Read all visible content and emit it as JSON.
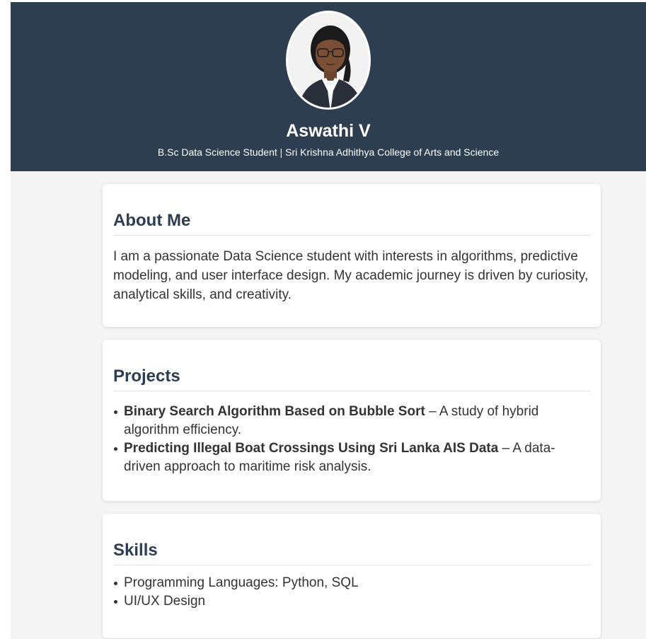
{
  "header": {
    "name": "Aswathi V",
    "subtitle": "B.Sc Data Science Student | Sri Krishna Adhithya College of Arts and Science"
  },
  "about": {
    "title": "About Me",
    "text": "I am a passionate Data Science student with interests in algorithms, predictive modeling, and user interface design. My academic journey is driven by curiosity, analytical skills, and creativity."
  },
  "projects": {
    "title": "Projects",
    "items": [
      {
        "name": "Binary Search Algorithm Based on Bubble Sort",
        "desc": " – A study of hybrid algorithm efficiency."
      },
      {
        "name": "Predicting Illegal Boat Crossings Using Sri Lanka AIS Data",
        "desc": " – A data-driven approach to maritime risk analysis."
      }
    ]
  },
  "skills": {
    "title": "Skills",
    "items": [
      "Programming Languages: Python, SQL",
      "UI/UX Design"
    ]
  },
  "colors": {
    "header_bg": "#2c3e50",
    "page_bg": "#f4f4f4",
    "heading": "#2c3e50"
  }
}
